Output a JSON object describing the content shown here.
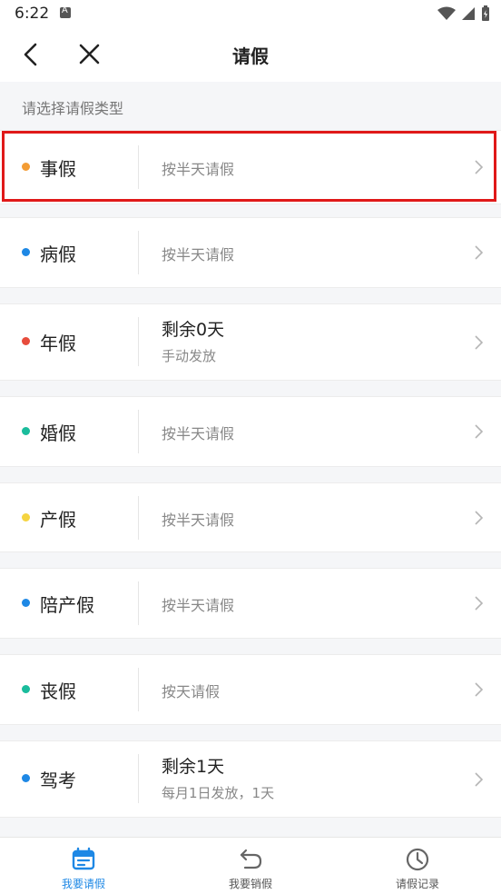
{
  "status_bar": {
    "time": "6:22"
  },
  "header": {
    "title": "请假"
  },
  "section": {
    "title": "请选择请假类型"
  },
  "leave_types": [
    {
      "name": "事假",
      "dot_color": "#f39c34",
      "rule": "按半天请假"
    },
    {
      "name": "病假",
      "dot_color": "#1e88e5",
      "rule": "按半天请假"
    },
    {
      "name": "年假",
      "dot_color": "#e74c3c",
      "remaining": "剩余0天",
      "note": "手动发放"
    },
    {
      "name": "婚假",
      "dot_color": "#1abc9c",
      "rule": "按半天请假"
    },
    {
      "name": "产假",
      "dot_color": "#f5d440",
      "rule": "按半天请假"
    },
    {
      "name": "陪产假",
      "dot_color": "#1e88e5",
      "rule": "按半天请假"
    },
    {
      "name": "丧假",
      "dot_color": "#1abc9c",
      "rule": "按天请假"
    },
    {
      "name": "驾考",
      "dot_color": "#1e88e5",
      "remaining": "剩余1天",
      "note": "每月1日发放，1天"
    }
  ],
  "tabs": [
    {
      "label": "我要请假",
      "icon": "calendar-icon",
      "active": true
    },
    {
      "label": "我要销假",
      "icon": "undo-arrow-icon",
      "active": false
    },
    {
      "label": "请假记录",
      "icon": "clock-icon",
      "active": false
    }
  ],
  "colors": {
    "accent": "#1e88e5",
    "highlight": "#e01919"
  }
}
